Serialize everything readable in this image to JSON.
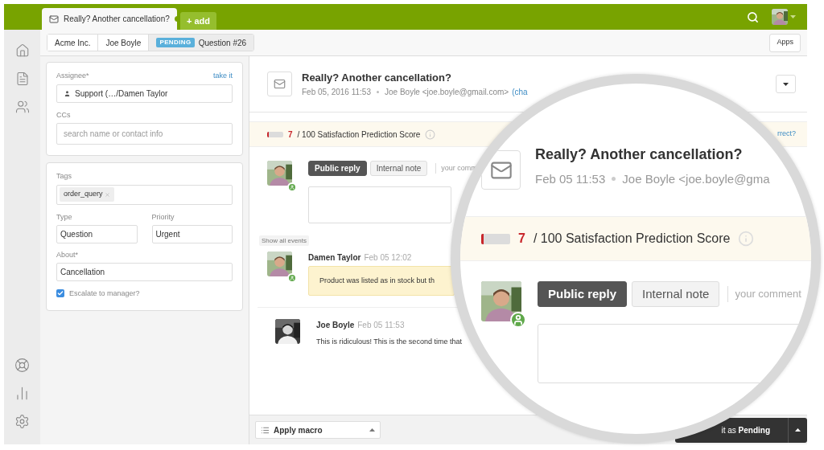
{
  "topbar": {
    "tabs": [
      {
        "label": "Really? Another cancellation?",
        "kind": "ticket",
        "selected": true
      },
      {
        "label": "+ add",
        "kind": "add",
        "selected": false
      }
    ]
  },
  "breadcrumbs": [
    {
      "label": "Acme Inc.",
      "selected": false
    },
    {
      "label": "Joe Boyle",
      "selected": false
    },
    {
      "label": "Question #26",
      "badge": "PENDING",
      "selected": true
    }
  ],
  "apps_button": "Apps",
  "fields": {
    "assignee": {
      "label": "Assignee*",
      "action": "take it",
      "value": "Support (…/Damen Taylor"
    },
    "ccs": {
      "label": "CCs",
      "placeholder": "search name or contact info"
    },
    "tags": {
      "label": "Tags",
      "items": [
        "order_query"
      ]
    },
    "type": {
      "label": "Type",
      "value": "Question"
    },
    "priority": {
      "label": "Priority",
      "value": "Urgent"
    },
    "about": {
      "label": "About*",
      "value": "Cancellation"
    },
    "escalate": {
      "label": "Escalate to manager?",
      "checked": true
    }
  },
  "ticket": {
    "title": "Really? Another cancellation?",
    "date": "Feb 05, 2016 11:53",
    "requester": "Joe Boyle <joe.boyle@gmail.com>",
    "change_link": "(cha"
  },
  "satisfaction": {
    "level": 0.07,
    "score": "7",
    "caption": "/ 100 Satisfaction Prediction Score",
    "link": "rrect?"
  },
  "composer": {
    "modes": [
      {
        "label": "Public reply",
        "selected": true
      },
      {
        "label": "Internal note",
        "selected": false
      }
    ],
    "hint": "your comm"
  },
  "show_all_events": "Show all events",
  "events": [
    {
      "kind": "internal",
      "author": "Damen Taylor",
      "time": "Feb 05 12:02",
      "body": "Product was listed as in stock but th"
    },
    {
      "kind": "public",
      "author": "Joe Boyle",
      "time": "Feb 05 11:53",
      "body": "This is ridiculous! This is the second time that"
    }
  ],
  "footer": {
    "macro": "Apply macro",
    "submit": "it as **Pending**"
  },
  "magnifier": {
    "title": "Really? Another cancellation?",
    "date": "Feb 05 11:53",
    "requester": "Joe Boyle <joe.boyle@gma",
    "score": "7",
    "caption": "/ 100 Satisfaction Prediction Score",
    "level": 0.07,
    "modes": [
      {
        "label": "Public reply",
        "selected": true
      },
      {
        "label": "Internal note",
        "selected": false
      }
    ],
    "hint": "your comment"
  }
}
